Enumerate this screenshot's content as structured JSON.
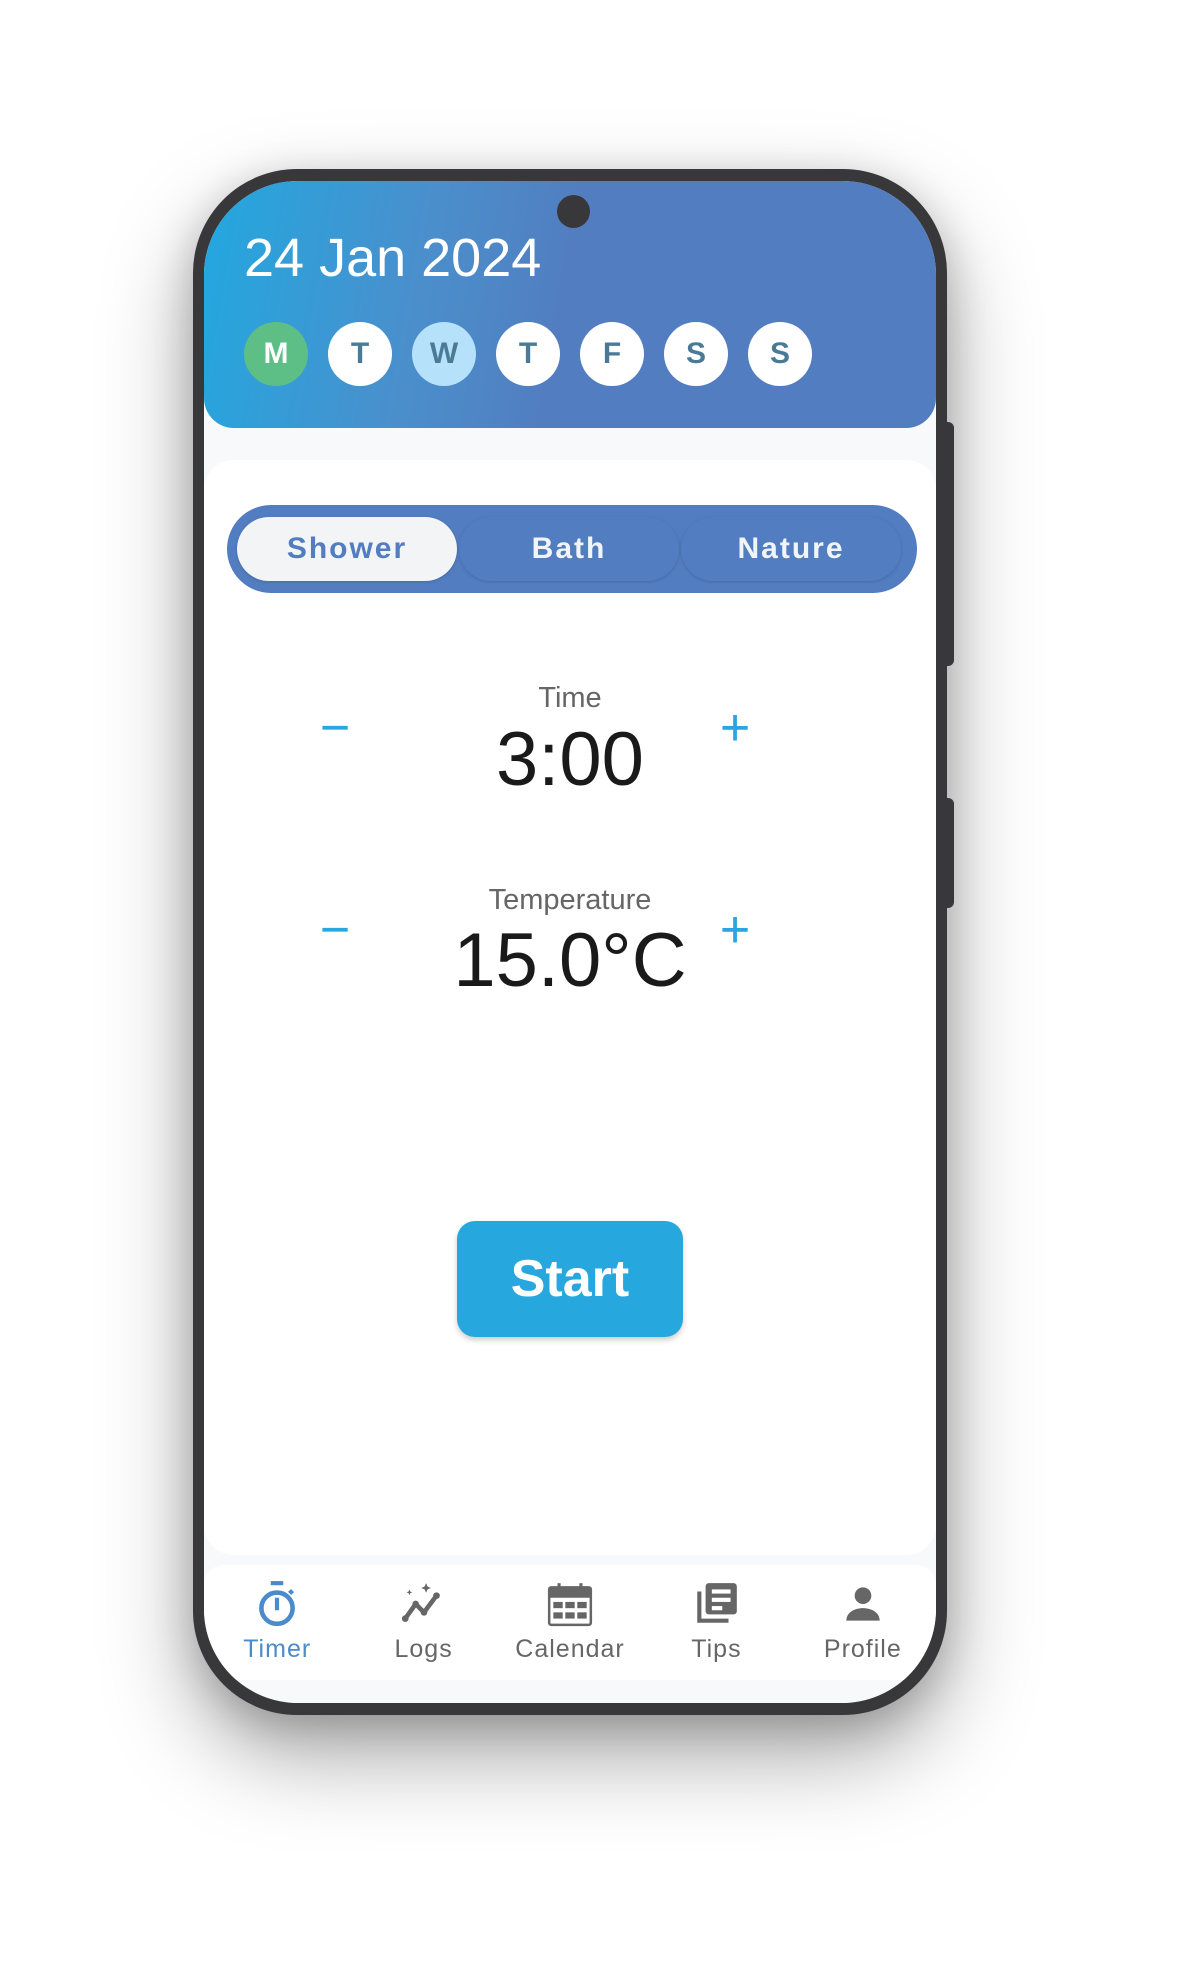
{
  "header": {
    "date": "24 Jan 2024",
    "days": [
      {
        "label": "M",
        "state": "done"
      },
      {
        "label": "T",
        "state": "upcoming"
      },
      {
        "label": "W",
        "state": "today"
      },
      {
        "label": "T",
        "state": "upcoming"
      },
      {
        "label": "F",
        "state": "upcoming"
      },
      {
        "label": "S",
        "state": "upcoming"
      },
      {
        "label": "S",
        "state": "upcoming"
      }
    ]
  },
  "modes": {
    "selected": "Shower",
    "options": [
      "Shower",
      "Bath",
      "Nature"
    ]
  },
  "time": {
    "label": "Time",
    "value": "3:00",
    "decrement": "−",
    "increment": "+"
  },
  "temperature": {
    "label": "Temperature",
    "value": "15.0°C",
    "decrement": "−",
    "increment": "+"
  },
  "start_label": "Start",
  "nav": {
    "active": "Timer",
    "items": [
      {
        "label": "Timer",
        "icon": "stopwatch-icon"
      },
      {
        "label": "Logs",
        "icon": "trend-sparkle-icon"
      },
      {
        "label": "Calendar",
        "icon": "calendar-icon"
      },
      {
        "label": "Tips",
        "icon": "library-books-icon"
      },
      {
        "label": "Profile",
        "icon": "person-icon"
      }
    ]
  },
  "colors": {
    "header_gradient_start": "#22a8e0",
    "header_gradient_end": "#527dc0",
    "accent": "#26a8df",
    "segment_bg": "#527dc0",
    "day_done": "#5dbf85",
    "day_today": "#b5e2fa",
    "nav_active": "#4a8bcc"
  }
}
